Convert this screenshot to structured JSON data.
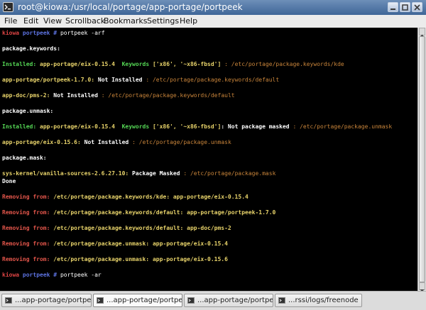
{
  "window": {
    "title": "root@kiowa:/usr/local/portage/app-portage/portpeek"
  },
  "menu": [
    "File",
    "Edit",
    "View",
    "Scrollback",
    "Bookmarks",
    "Settings",
    "Help"
  ],
  "terminal": {
    "prompt": {
      "host": "kiowa",
      "dir": "portpeek",
      "sym": "#"
    },
    "command1": "portpeek -arf",
    "h_keywords": "package.keywords:",
    "k1": {
      "status": "Installed:",
      "pkg": "app-portage/eix-0.15.4",
      "kw_label": "Keywords",
      "kw": "['x86', '~x86-fbsd']",
      "sep": ":",
      "path": "/etc/portage/package.keywords/kde"
    },
    "k2": {
      "pkg": "app-portage/portpeek-1.7.0:",
      "state": "Not Installed",
      "sep": ":",
      "path": "/etc/portage/package.keywords/default"
    },
    "k3": {
      "pkg": "app-doc/pms-2:",
      "state": "Not Installed",
      "sep": ":",
      "path": "/etc/portage/package.keywords/default"
    },
    "h_unmask": "package.unmask:",
    "u1": {
      "status": "Installed:",
      "pkg": "app-portage/eix-0.15.4",
      "kw_label": "Keywords",
      "kw": "['x86', '~x86-fbsd']",
      "state": ": Not package masked",
      "sep": ":",
      "path": "/etc/portage/package.unmask"
    },
    "u2": {
      "pkg": "app-portage/eix-0.15.6:",
      "state": "Not Installed",
      "sep": ":",
      "path": "/etc/portage/package.unmask"
    },
    "h_mask": "package.mask:",
    "m1": {
      "pkg": "sys-kernel/vanilla-sources-2.6.27.10:",
      "state": "Package Masked",
      "sep": ":",
      "path": "/etc/portage/package.mask"
    },
    "done": "Done",
    "removing_label": "Removing from:",
    "r1": {
      "path": "/etc/portage/package.keywords/kde:",
      "pkg": "app-portage/eix-0.15.4"
    },
    "r2": {
      "path": "/etc/portage/package.keywords/default:",
      "pkg": "app-portage/portpeek-1.7.0"
    },
    "r3": {
      "path": "/etc/portage/package.keywords/default:",
      "pkg": "app-doc/pms-2"
    },
    "r4": {
      "path": "/etc/portage/package.unmask:",
      "pkg": "app-portage/eix-0.15.4"
    },
    "r5": {
      "path": "/etc/portage/package.unmask:",
      "pkg": "app-portage/eix-0.15.6"
    },
    "command2": "portpeek -ar"
  },
  "tabs": [
    {
      "label": "...app-portage/portpeek",
      "active": false
    },
    {
      "label": "...app-portage/portpeek",
      "active": true
    },
    {
      "label": "...app-portage/portpeek",
      "active": false
    },
    {
      "label": "...rssi/logs/freenode",
      "active": false
    }
  ],
  "colors": {
    "titlebar": "#3f6698",
    "terminal_bg": "#000000",
    "prompt_host": "#d44444",
    "prompt_dir": "#5c72e0",
    "installed": "#55d755",
    "package": "#e8d36a",
    "path": "#c8843a",
    "removing": "#e2554a"
  },
  "icons": [
    "terminal-app-icon",
    "minimize-icon",
    "maximize-icon",
    "close-icon",
    "scroll-up-arrow-icon",
    "scroll-down-arrow-icon",
    "terminal-tab-icon"
  ]
}
